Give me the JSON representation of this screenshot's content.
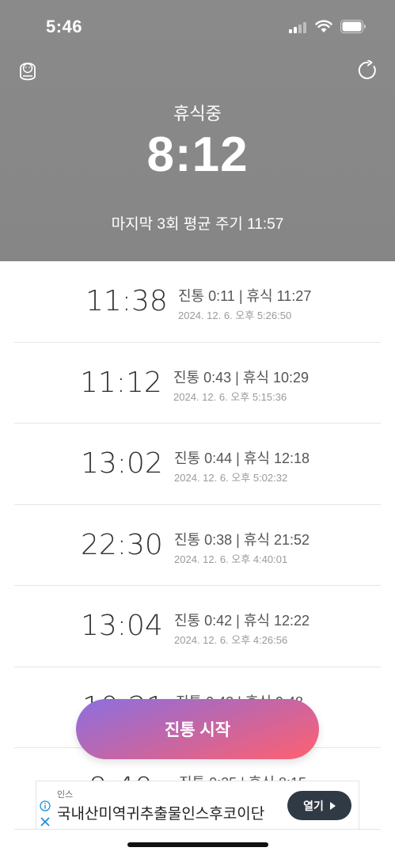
{
  "status_bar": {
    "time": "5:46",
    "icons": [
      "cellular-signal-icon",
      "wifi-icon",
      "battery-icon"
    ]
  },
  "header": {
    "status_label": "휴식중",
    "timer": "8:12",
    "average_text": "마지막 3회 평균 주기 11:57",
    "icons": [
      "baby-icon",
      "reset-icon"
    ],
    "background_color": "#888888"
  },
  "contractions": [
    {
      "interval": "11:38",
      "summary": "진통 0:11 | 휴식 11:27",
      "timestamp": "2024. 12. 6. 오후 5:26:50"
    },
    {
      "interval": "11:12",
      "summary": "진통 0:43 | 휴식 10:29",
      "timestamp": "2024. 12. 6. 오후 5:15:36"
    },
    {
      "interval": "13:02",
      "summary": "진통 0:44 | 휴식 12:18",
      "timestamp": "2024. 12. 6. 오후 5:02:32"
    },
    {
      "interval": "22:30",
      "summary": "진통 0:38 | 휴식 21:52",
      "timestamp": "2024. 12. 6. 오후 4:40:01"
    },
    {
      "interval": "13:04",
      "summary": "진통 0:42 | 휴식 12:22",
      "timestamp": "2024. 12. 6. 오후 4:26:56"
    },
    {
      "interval": "10:21",
      "summary": "진통 0:43 | 휴식 9:48",
      "timestamp": ""
    },
    {
      "interval": "8:40",
      "summary": "진통 0:25 | 휴식 8:15",
      "timestamp": ""
    }
  ],
  "start_button": {
    "label": "진통 시작"
  },
  "ad": {
    "sponsor": "인스",
    "title": "국내산미역귀추출물인스후코이단",
    "open_label": "열기"
  }
}
